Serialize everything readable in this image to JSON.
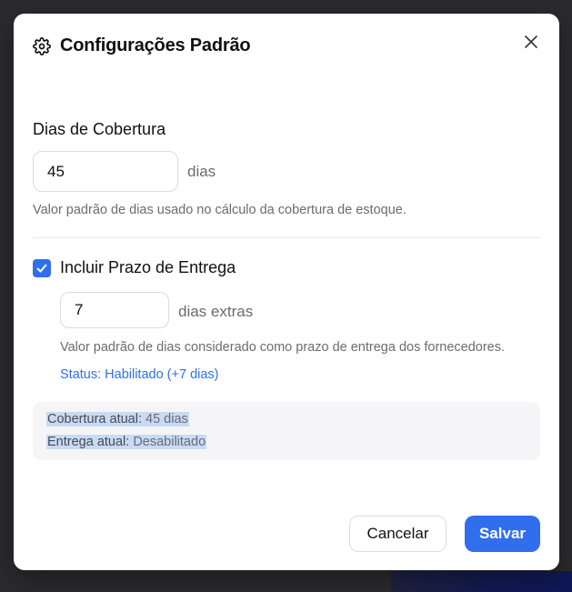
{
  "dialog": {
    "title": "Configurações Padrão",
    "icon": "gear-icon",
    "close_icon": "close-icon"
  },
  "coverage": {
    "label": "Dias de Cobertura",
    "value": "45",
    "unit": "dias",
    "help": "Valor padrão de dias usado no cálculo da cobertura de estoque."
  },
  "lead_time": {
    "checkbox_label": "Incluir Prazo de Entrega",
    "checked": true,
    "value": "7",
    "unit": "dias extras",
    "help": "Valor padrão de dias considerado como prazo de entrega dos fornecedores.",
    "status": "Status: Habilitado (+7 dias)"
  },
  "summary": {
    "coverage_key": "Cobertura atual:",
    "coverage_value": "45 dias",
    "lead_key": "Entrega atual:",
    "lead_value": "Desabilitado"
  },
  "footer": {
    "cancel_label": "Cancelar",
    "save_label": "Salvar"
  },
  "colors": {
    "accent": "#2f6fed",
    "selection": "#c9daf5"
  }
}
